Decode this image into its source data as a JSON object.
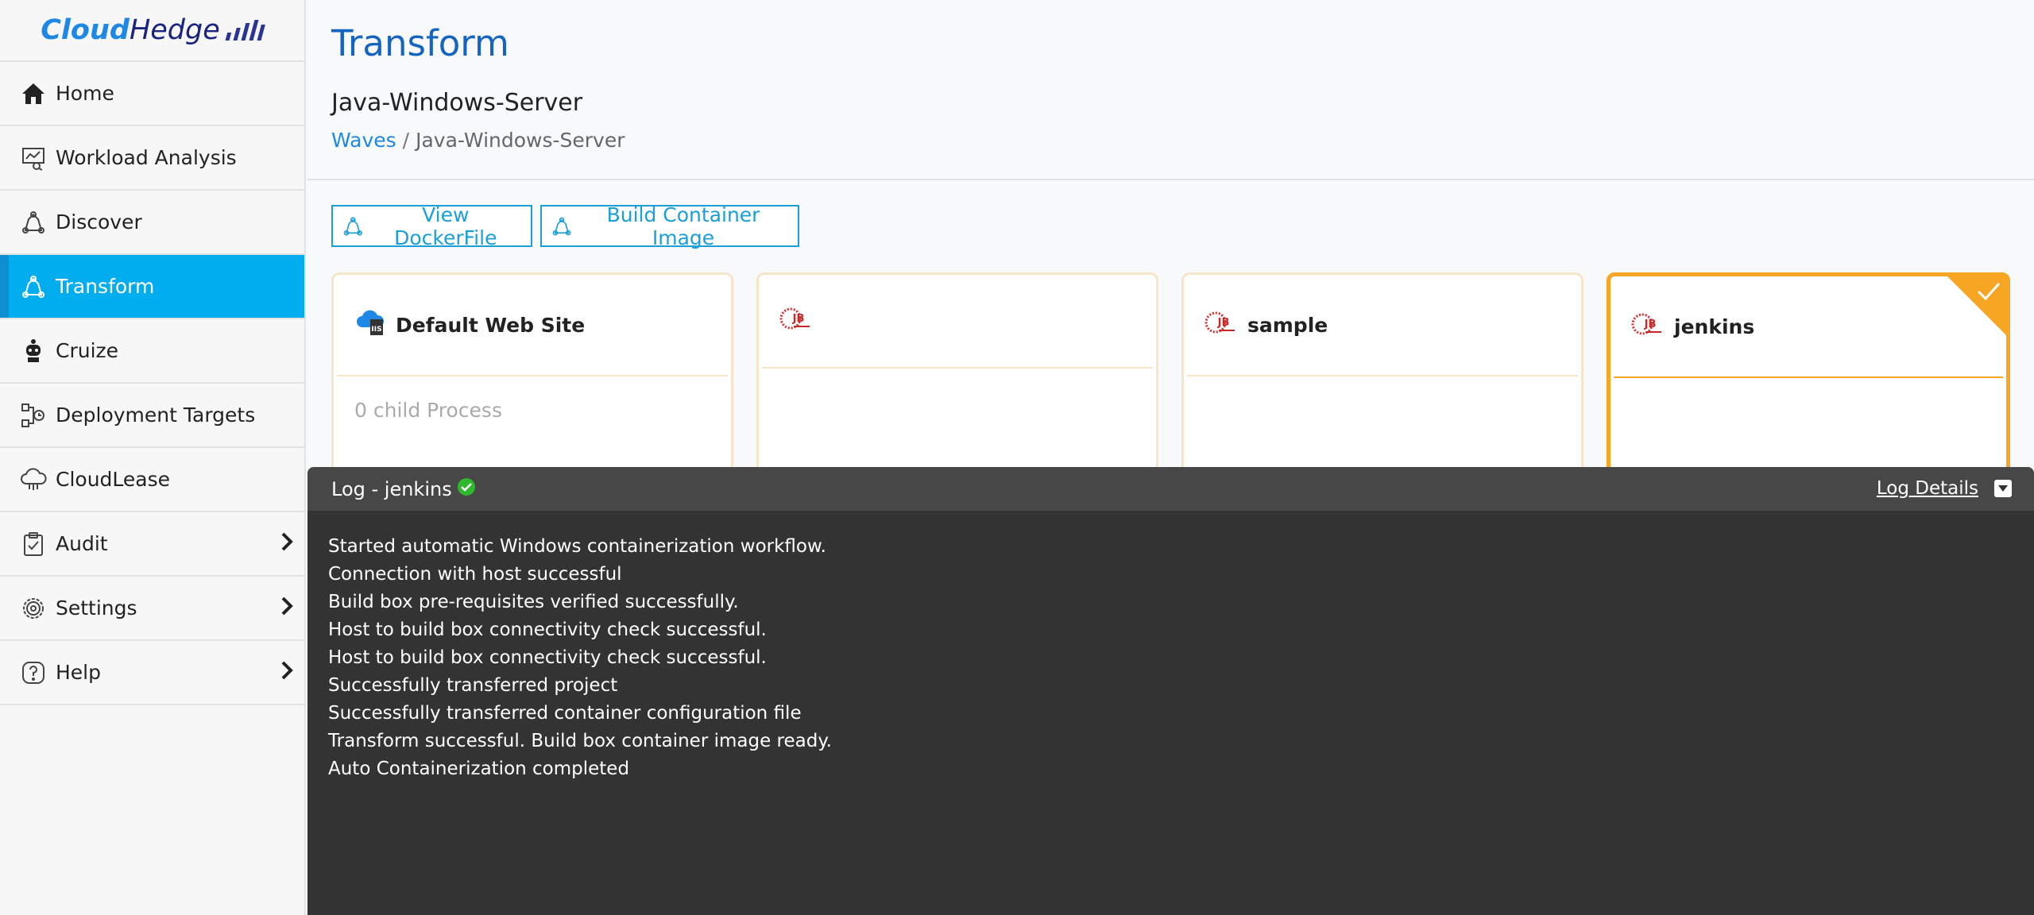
{
  "brand": {
    "part1": "Cloud",
    "part2": "Hedge"
  },
  "sidebar": {
    "items": [
      {
        "label": "Home",
        "icon": "home-icon"
      },
      {
        "label": "Workload Analysis",
        "icon": "analysis-icon"
      },
      {
        "label": "Discover",
        "icon": "discover-icon"
      },
      {
        "label": "Transform",
        "icon": "transform-icon",
        "active": true
      },
      {
        "label": "Cruize",
        "icon": "robot-icon"
      },
      {
        "label": "Deployment Targets",
        "icon": "deployment-icon"
      },
      {
        "label": "CloudLease",
        "icon": "cloud-icon"
      },
      {
        "label": "Audit",
        "icon": "clipboard-icon",
        "expandable": true
      },
      {
        "label": "Settings",
        "icon": "gear-icon",
        "expandable": true
      },
      {
        "label": "Help",
        "icon": "help-icon",
        "expandable": true
      }
    ]
  },
  "header": {
    "title": "Transform",
    "subtitle": "Java-Windows-Server",
    "breadcrumb": {
      "link": "Waves",
      "separator": "/",
      "current": "Java-Windows-Server"
    }
  },
  "toolbar": {
    "view_dockerfile": "View DockerFile",
    "build_image": "Build Container Image"
  },
  "cards": [
    {
      "name": "Default Web Site",
      "icon": "iis-icon",
      "child_text": "0 child Process"
    },
    {
      "name": "",
      "icon": "jboss-icon"
    },
    {
      "name": "sample",
      "icon": "jboss-icon"
    },
    {
      "name": "jenkins",
      "icon": "jboss-icon",
      "selected": true
    }
  ],
  "log": {
    "title": "Log - jenkins",
    "details_label": "Log Details",
    "lines": [
      "Started automatic Windows containerization workflow.",
      "Connection with host successful",
      "Build box pre-requisites verified successfully.",
      "Host to build box connectivity check successful.",
      "Host to build box connectivity check successful.",
      "Successfully transferred project",
      "Successfully transferred container configuration file",
      "Transform successful. Build box container image ready.",
      "Auto Containerization completed"
    ]
  },
  "colors": {
    "accent": "#00adef",
    "title_blue": "#1565c0",
    "selected_card": "#f6a623",
    "log_bg": "#333333"
  }
}
